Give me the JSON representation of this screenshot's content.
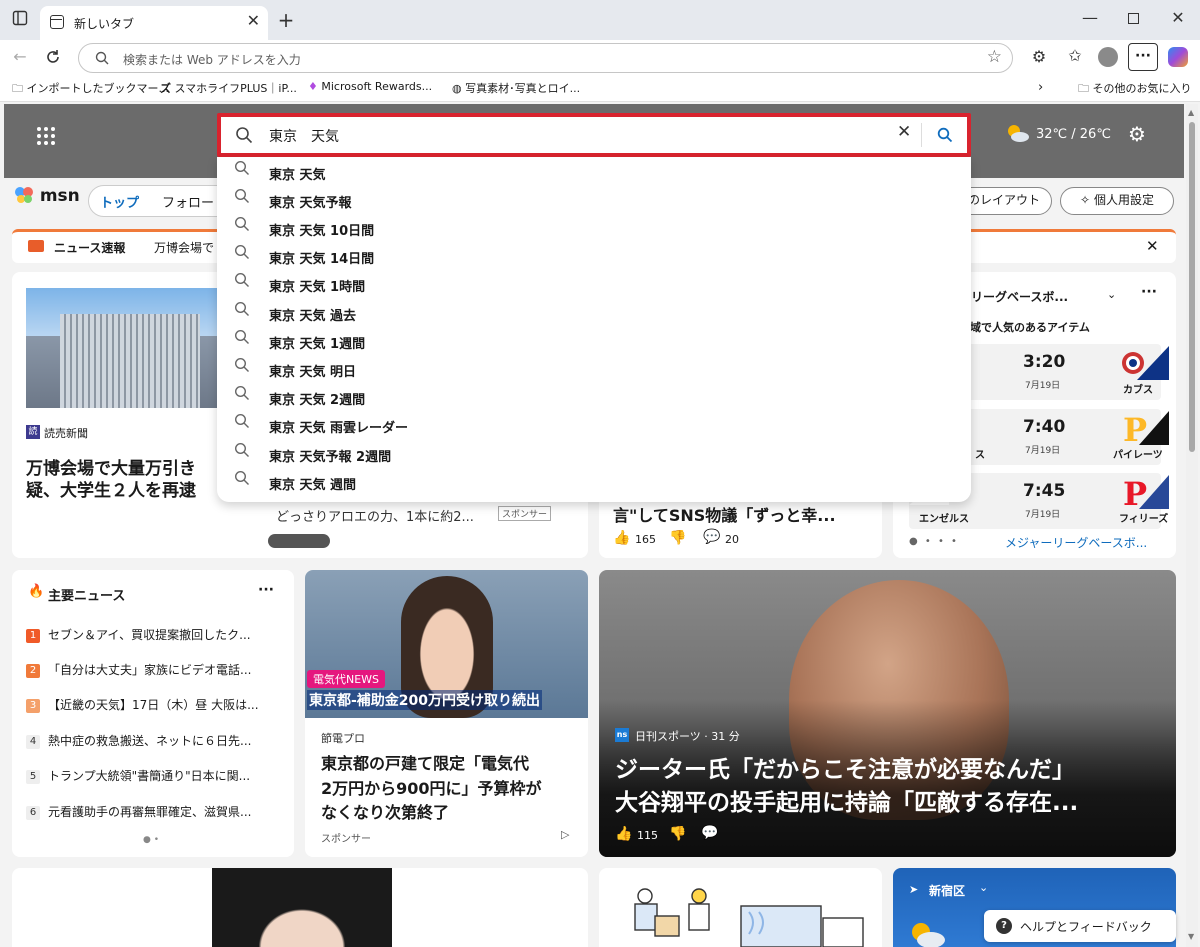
{
  "browser": {
    "tab_title": "新しいタブ",
    "url_placeholder": "検索または Web アドレスを入力",
    "bookmarks": [
      "インポートしたブックマー...",
      "スマホライフPLUS｜iP...",
      "Microsoft Rewards...",
      "写真素材･写真とロイ...",
      "その他のお気に入り"
    ]
  },
  "msn": {
    "logo": "msn",
    "weather": "32℃ / 26℃",
    "nav_top": "トップ",
    "nav_follow": "フォロー",
    "layout_btn": "のレイアウト",
    "personalize_btn": "個人用設定",
    "breaking_label": "ニュース速報",
    "breaking_text": "万博会場で"
  },
  "search": {
    "query": "東京　天気",
    "suggestions": [
      "東京 天気",
      "東京 天気予報",
      "東京 天気 10日間",
      "東京 天気 14日間",
      "東京 天気 1時間",
      "東京 天気 過去",
      "東京 天気 1週間",
      "東京 天気 明日",
      "東京 天気 2週間",
      "東京 天気 雨雲レーダー",
      "東京 天気予報 2週間",
      "東京 天気 週間"
    ]
  },
  "main_story": {
    "source": "読売新聞",
    "headline_1": "万博会場で大量万引き",
    "headline_2": "疑、大学生２人を再逮",
    "sub_text": "どっさりアロエの力、1本に約2...",
    "sponsor_tag": "スポンサー"
  },
  "mid_story": {
    "headline": "言\"してSNS物議「ずっと幸...",
    "likes": "165",
    "comments": "20"
  },
  "sports": {
    "title": "ーリーグベースボ...",
    "subtitle": "地域で人気のあるアイテム",
    "games": [
      {
        "time": "3:20",
        "date": "7月19日",
        "team": "カブス",
        "left_team": ""
      },
      {
        "time": "7:40",
        "date": "7月19日",
        "team": "パイレーツ",
        "left_team": "ス"
      },
      {
        "time": "7:45",
        "date": "7月19日",
        "team": "フィリーズ",
        "left_team": "エンゼルス"
      }
    ],
    "link": "メジャーリーグベースボ..."
  },
  "top_news": {
    "title": "主要ニュース",
    "items": [
      {
        "n": "1",
        "text": "セブン＆アイ、買収提案撤回したク..."
      },
      {
        "n": "2",
        "text": "「自分は大丈夫」家族にビデオ電話..."
      },
      {
        "n": "3",
        "text": "【近畿の天気】17日（木）昼 大阪は..."
      },
      {
        "n": "4",
        "text": "熱中症の救急搬送、ネットに６日先..."
      },
      {
        "n": "5",
        "text": "トランプ大統領\"書簡通り\"日本に関..."
      },
      {
        "n": "6",
        "text": "元看護助手の再審無罪確定、滋賀県..."
      }
    ]
  },
  "ad_story": {
    "badge": "電気代NEWS",
    "overlay": "東京都-補助金200万円受け取り続出",
    "source": "節電プロ",
    "headline_1": "東京都の戸建て限定「電気代",
    "headline_2": "2万円から900円に」予算枠が",
    "headline_3": "なくなり次第終了",
    "sponsor": "スポンサー"
  },
  "hero_story": {
    "source_icon": "ns",
    "source": "日刊スポーツ · 31 分",
    "headline_1": "ジーター氏「だからこそ注意が必要なんだ」",
    "headline_2": "大谷翔平の投手起用に持論「匹敵する存在...",
    "likes": "115"
  },
  "location": {
    "name": "新宿区"
  },
  "help": {
    "label": "ヘルプとフィードバック"
  }
}
